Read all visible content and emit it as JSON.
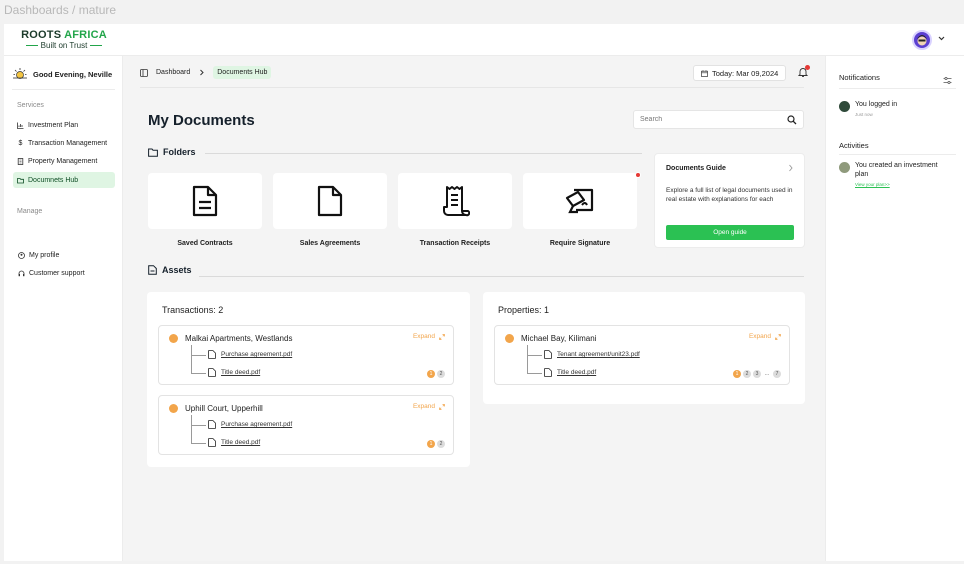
{
  "canvas_title": "Dashboards / mature",
  "brand": {
    "name_part1": "ROOTS",
    "name_part2": "AFRICA",
    "tagline": "Built on Trust"
  },
  "sidebar": {
    "greeting": "Good Evening, Neville",
    "services_label": "Services",
    "services": [
      {
        "label": "Investment Plan",
        "icon": "chart-icon"
      },
      {
        "label": "Transaction Management",
        "icon": "dollar-icon"
      },
      {
        "label": "Property Management",
        "icon": "building-icon"
      },
      {
        "label": "Documnets Hub",
        "icon": "folder-icon",
        "active": true
      }
    ],
    "manage_label": "Manage",
    "manage": [
      {
        "label": "My profile",
        "icon": "profile-icon"
      },
      {
        "label": "Customer support",
        "icon": "headset-icon"
      }
    ]
  },
  "breadcrumb": {
    "items": [
      "Dashboard",
      "Documents Hub"
    ]
  },
  "header": {
    "today": "Today: Mar 09,2024"
  },
  "main": {
    "title": "My Documents",
    "search_placeholder": "Search",
    "folders_label": "Folders",
    "folders": [
      {
        "label": "Saved Contracts",
        "icon": "document-lines-icon"
      },
      {
        "label": "Sales Agreements",
        "icon": "blank-document-icon"
      },
      {
        "label": "Transaction Receipts",
        "icon": "receipt-icon"
      },
      {
        "label": "Require Signature",
        "icon": "signature-icon"
      }
    ],
    "guide": {
      "title": "Documents Guide",
      "text": "Explore a full list of legal documents used in real estate with explanations for each",
      "button": "Open guide"
    },
    "assets_label": "Assets",
    "transactions": {
      "title": "Transactions: 2",
      "items": [
        {
          "name": "Malkai Apartments, Westlands",
          "expand": "Expand",
          "files": [
            "Purchase agreement.pdf",
            "Title deed.pdf"
          ],
          "pages": [
            "1",
            "2"
          ]
        },
        {
          "name": "Uphill Court, Upperhill",
          "expand": "Expand",
          "files": [
            "Purchase agreement.pdf",
            "Title deed.pdf"
          ],
          "pages": [
            "1",
            "2"
          ]
        }
      ]
    },
    "properties": {
      "title": "Properties: 1",
      "items": [
        {
          "name": "Michael Bay, Kilimani",
          "expand": "Expand",
          "files": [
            "Tenant agreement/unit23.pdf",
            "Title deed.pdf"
          ],
          "pages": [
            "1",
            "2",
            "3",
            "...",
            "7"
          ]
        }
      ]
    }
  },
  "right_panel": {
    "notifications_label": "Notifications",
    "notifications": [
      {
        "text": "You logged in",
        "sub": "Just now",
        "color": "#2f4a3a"
      }
    ],
    "activities_label": "Activities",
    "activities": [
      {
        "text": "You created an investment plan",
        "link": "View your plan>>",
        "color": "#8f9a7c"
      }
    ]
  },
  "colors": {
    "brand_green": "#22a54a",
    "button_green": "#2bc153",
    "accent_orange": "#f2a54b",
    "active_bg": "#dff5e3",
    "alert_red": "#e53935"
  }
}
